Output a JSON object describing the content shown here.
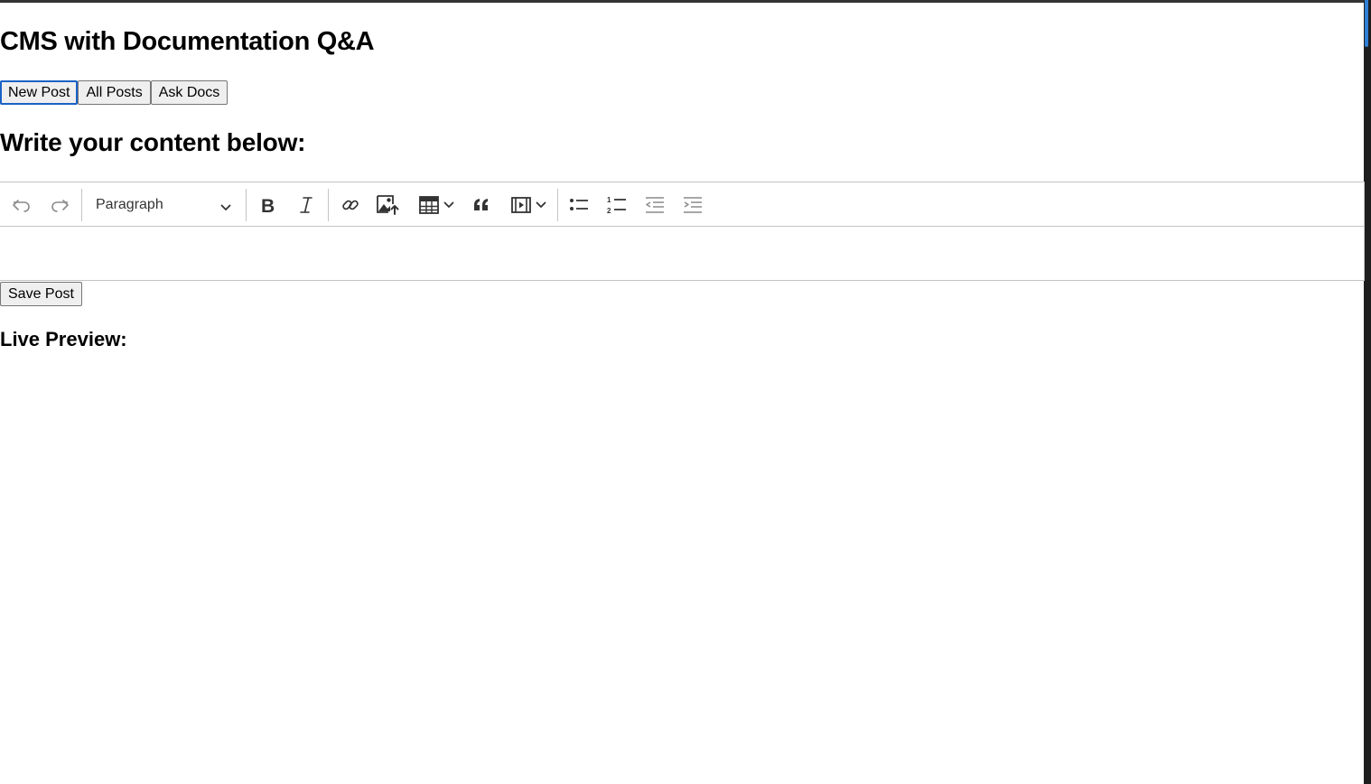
{
  "page": {
    "title": "CMS with Documentation Q&A"
  },
  "nav": {
    "tabs": [
      {
        "label": "New Post",
        "active": true
      },
      {
        "label": "All Posts",
        "active": false
      },
      {
        "label": "Ask Docs",
        "active": false
      }
    ]
  },
  "editor_section": {
    "heading": "Write your content below:",
    "toolbar": {
      "heading_select_value": "Paragraph",
      "icons": [
        "undo-icon",
        "redo-icon",
        "bold-icon",
        "italic-icon",
        "link-icon",
        "image-upload-icon",
        "table-icon",
        "blockquote-icon",
        "media-embed-icon",
        "bulleted-list-icon",
        "numbered-list-icon",
        "outdent-icon",
        "indent-icon"
      ]
    },
    "content": ""
  },
  "actions": {
    "save_label": "Save Post"
  },
  "preview": {
    "heading": "Live Preview:",
    "content": ""
  },
  "colors": {
    "accent": "#1a62c6",
    "toolbar_border": "#c4c4c4",
    "icon": "#333333",
    "icon_disabled": "#8a8a8a"
  }
}
